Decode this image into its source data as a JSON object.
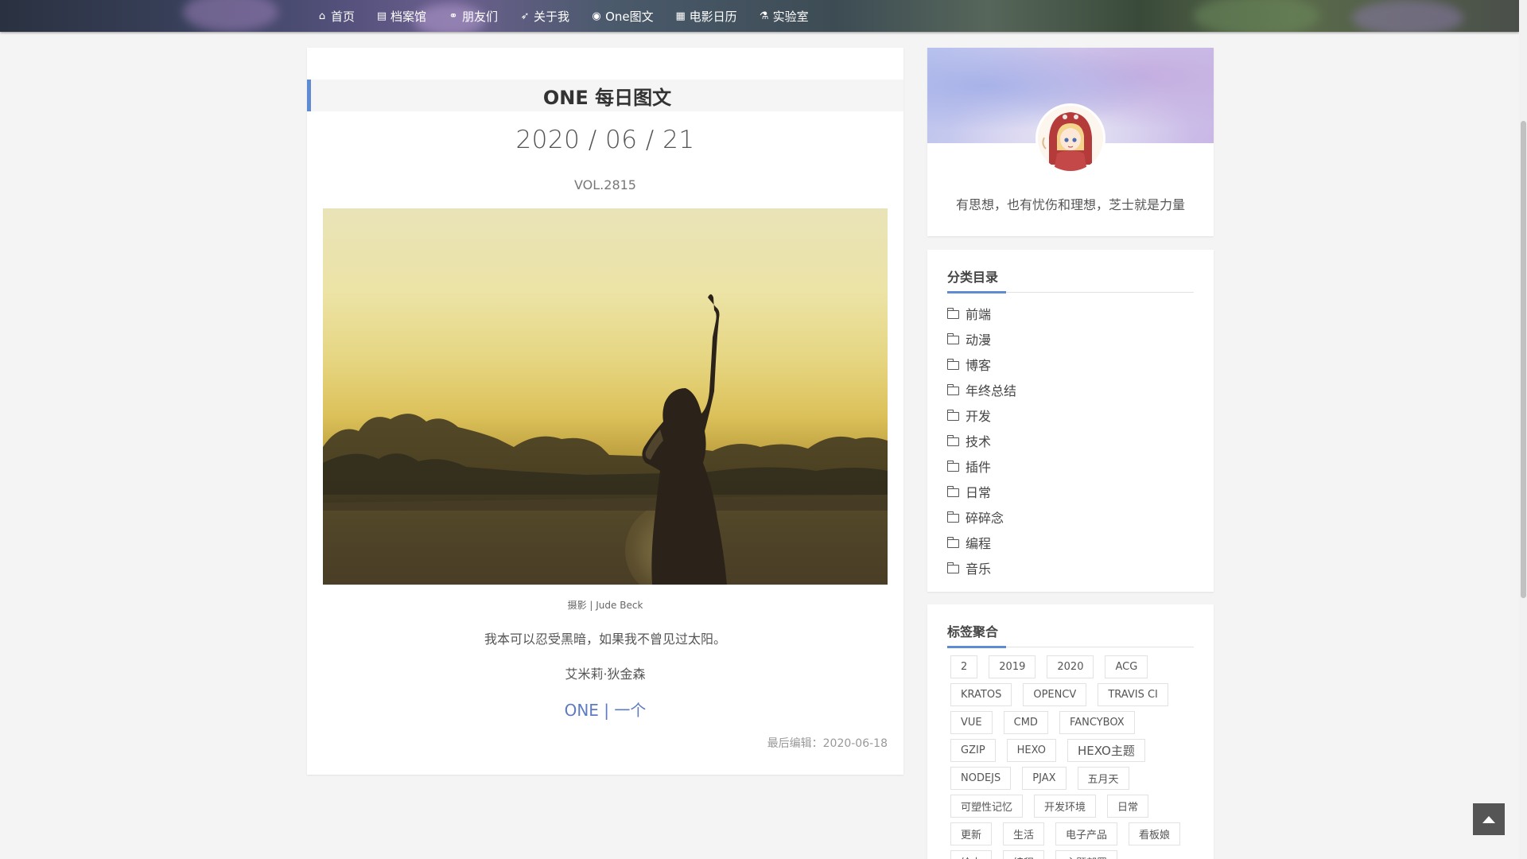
{
  "nav": {
    "items": [
      {
        "label": "首页",
        "icon": "home-icon"
      },
      {
        "label": "档案馆",
        "icon": "archive-icon"
      },
      {
        "label": "朋友们",
        "icon": "link-icon"
      },
      {
        "label": "关于我",
        "icon": "rocket-icon"
      },
      {
        "label": "One图文",
        "icon": "pin-icon"
      },
      {
        "label": "电影日历",
        "icon": "film-icon"
      },
      {
        "label": "实验室",
        "icon": "flask-icon"
      }
    ]
  },
  "article": {
    "title": "ONE 每日图文",
    "date": "2020 / 06 / 21",
    "vol": "VOL.2815",
    "photo_caption": "摄影 | Jude Beck",
    "quote": "我本可以忍受黑暗，如果我不曾见过太阳。",
    "author": "艾米莉·狄金森",
    "link": "ONE | 一个",
    "last_edited": "最后编辑：2020-06-18"
  },
  "profile": {
    "motto": "有思想，也有忧伤和理想，芝士就是力量"
  },
  "categories": {
    "title": "分类目录",
    "items": [
      "前端",
      "动漫",
      "博客",
      "年终总结",
      "开发",
      "技术",
      "插件",
      "日常",
      "碎碎念",
      "编程",
      "音乐"
    ]
  },
  "tags": {
    "title": "标签聚合",
    "items": [
      "2",
      "2019",
      "2020",
      "ACG",
      "KRATOS",
      "OPENCV",
      "TRAVIS CI",
      "VUE",
      "CMD",
      "FANCYBOX",
      "GZIP",
      "HEXO",
      "HEXO主题",
      "NODEJS",
      "PJAX",
      "五月天",
      "可塑性记忆",
      "开发环境",
      "日常",
      "更新",
      "生活",
      "电子产品",
      "看板娘",
      "绘本",
      "编程",
      "主题部署"
    ]
  },
  "colors": {
    "accent": "#5e8bd4",
    "link": "#5e7bc2"
  }
}
